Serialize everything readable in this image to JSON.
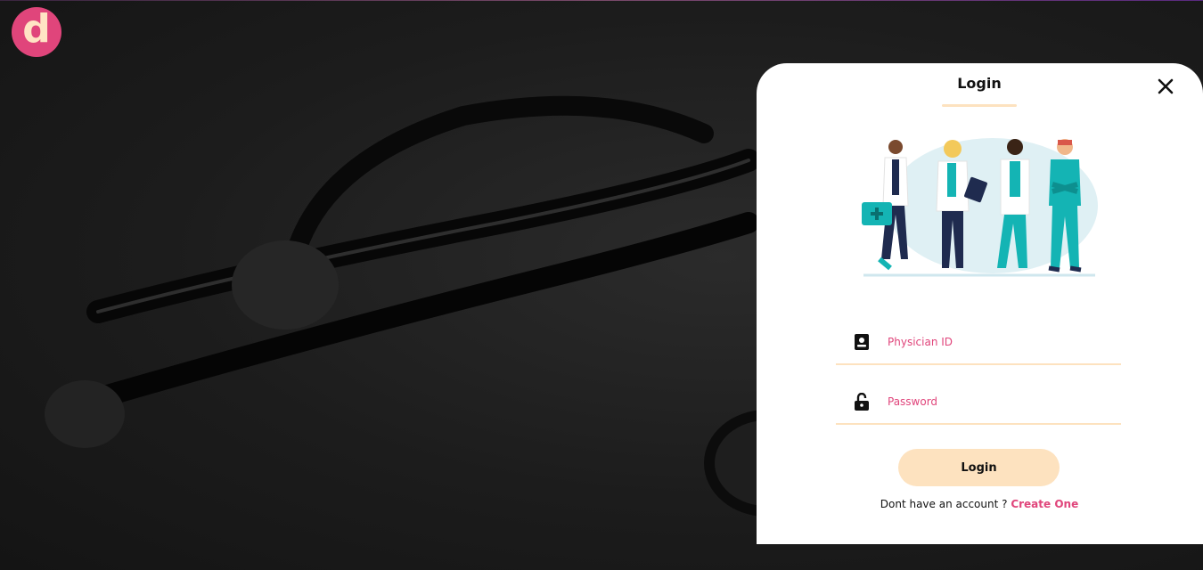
{
  "brand": {
    "logo_letter": "d",
    "logo_color": "#e0457b",
    "logo_text_color": "#ffe4c4"
  },
  "background": {
    "image": "stethoscope-background"
  },
  "login_modal": {
    "title": "Login",
    "close_icon": "close-icon",
    "illustration": "medical-team-illustration",
    "physician_id": {
      "placeholder": "Physician ID",
      "value": "",
      "icon": "id-badge-icon"
    },
    "password": {
      "placeholder": "Password",
      "value": "",
      "icon": "unlock-icon"
    },
    "login_button": "Login",
    "signup_prompt": "Dont have an account ? ",
    "signup_link": "Create One"
  },
  "colors": {
    "accent": "#e0457b",
    "highlight": "#fde2bf"
  }
}
